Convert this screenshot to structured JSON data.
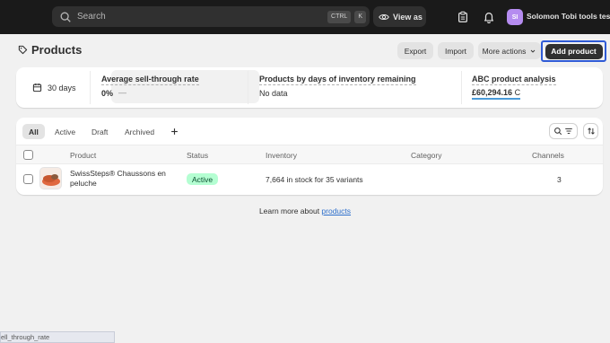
{
  "topbar": {
    "search_placeholder": "Search",
    "shortcut_ctrl": "CTRL",
    "shortcut_k": "K",
    "view_as_label": "View as",
    "avatar_initials": "SI",
    "store_name": "Solomon Tobi tools test"
  },
  "page": {
    "title": "Products",
    "export_label": "Export",
    "import_label": "Import",
    "more_actions_label": "More actions",
    "add_product_label": "Add product"
  },
  "metrics": {
    "date_range": "30 days",
    "sell_through_label": "Average sell-through rate",
    "sell_through_value": "0%",
    "sell_through_trend": "—",
    "days_inventory_label": "Products by days of inventory remaining",
    "days_inventory_value": "No data",
    "abc_label": "ABC product analysis",
    "abc_value": "£60,294.16",
    "abc_grade": "C"
  },
  "tabs": [
    {
      "label": "All",
      "active": true
    },
    {
      "label": "Active",
      "active": false
    },
    {
      "label": "Draft",
      "active": false
    },
    {
      "label": "Archived",
      "active": false
    }
  ],
  "table": {
    "columns": [
      "Product",
      "Status",
      "Inventory",
      "Category",
      "Channels"
    ],
    "rows": [
      {
        "product_line1": "SwissSteps® Chaussons en",
        "product_line2": "peluche",
        "status": "Active",
        "inventory": "7,664 in stock for 35 variants",
        "category": "",
        "channels": "3"
      }
    ]
  },
  "footer": {
    "learn_prefix": "Learn more about ",
    "learn_link": "products"
  },
  "status_bar_text": "ell_through_rate",
  "colors": {
    "topbar": "#1a1a1a",
    "primary_button": "#303030",
    "highlight_border": "#2f5bd6",
    "active_badge_bg": "#b4fed2",
    "link": "#2c6ecb"
  }
}
